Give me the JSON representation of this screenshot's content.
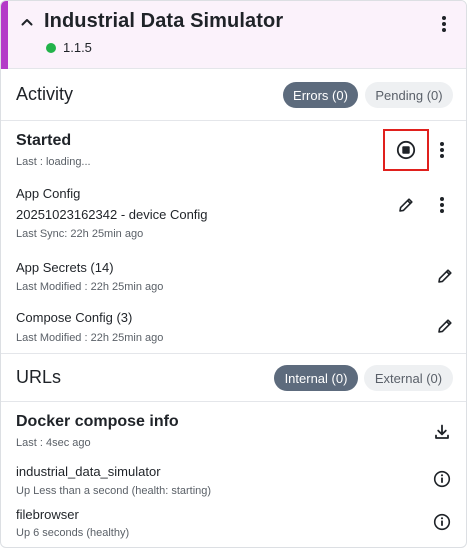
{
  "header": {
    "title": "Industrial Data Simulator",
    "version": "1.1.5",
    "status_color": "#22b34a",
    "accent_color": "#b43bc8",
    "icons": {
      "collapse": "chevron-up-icon",
      "menu": "more-vertical-icon"
    }
  },
  "activity": {
    "title": "Activity",
    "errors_label": "Errors (0)",
    "pending_label": "Pending (0)"
  },
  "status": {
    "title": "Started",
    "last": "Last : loading...",
    "icons": {
      "stop": "stop-circle-icon",
      "menu": "more-vertical-icon"
    }
  },
  "app_config": {
    "title": "App Config",
    "subtitle": "20251023162342 - device Config",
    "meta": "Last Sync: 22h 25min ago",
    "icons": {
      "edit": "pencil-icon",
      "menu": "more-vertical-icon"
    }
  },
  "app_secrets": {
    "title": "App Secrets (14)",
    "meta": "Last Modified : 22h 25min ago",
    "icons": {
      "edit": "pencil-icon"
    }
  },
  "compose_config": {
    "title": "Compose Config (3)",
    "meta": "Last Modified : 22h 25min ago",
    "icons": {
      "edit": "pencil-icon"
    }
  },
  "urls": {
    "title": "URLs",
    "internal_label": "Internal (0)",
    "external_label": "External (0)"
  },
  "docker": {
    "title": "Docker compose info",
    "last": "Last : 4sec ago",
    "icons": {
      "download": "download-icon"
    },
    "services": [
      {
        "name": "industrial_data_simulator",
        "status": "Up Less than a second (health: starting)",
        "icon": "info-icon"
      },
      {
        "name": "filebrowser",
        "status": "Up 6 seconds (healthy)",
        "icon": "info-icon"
      }
    ]
  }
}
